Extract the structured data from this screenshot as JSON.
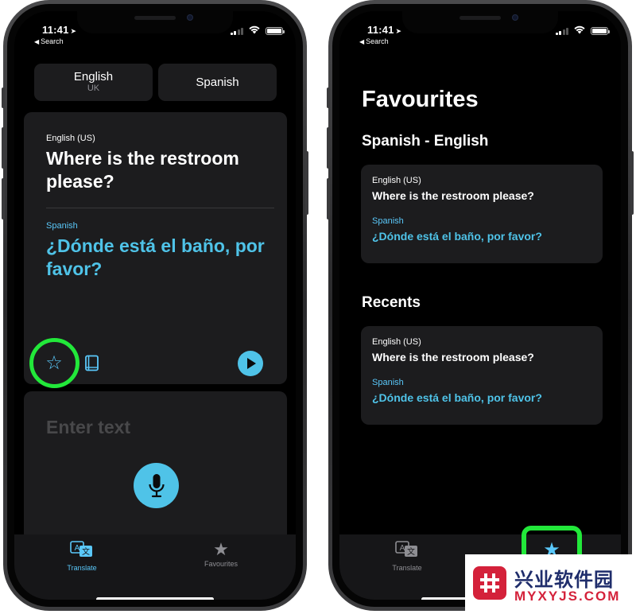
{
  "status_bar": {
    "time": "11:41",
    "back_label": "Search"
  },
  "translate_screen": {
    "source_language": {
      "name": "English",
      "region": "UK"
    },
    "target_language": {
      "name": "Spanish"
    },
    "translation": {
      "source_language_label": "English (US)",
      "source_text": "Where is the restroom please?",
      "target_language_label": "Spanish",
      "target_text": "¿Dónde está el baño, por favor?"
    },
    "input": {
      "placeholder": "Enter text"
    }
  },
  "favourites_screen": {
    "title": "Favourites",
    "favourites_section": {
      "heading": "Spanish - English",
      "items": [
        {
          "source_language": "English (US)",
          "source_text": "Where is the restroom please?",
          "target_language": "Spanish",
          "target_text": "¿Dónde está el baño, por favor?"
        }
      ]
    },
    "recents_section": {
      "heading": "Recents",
      "items": [
        {
          "source_language": "English (US)",
          "source_text": "Where is the restroom please?",
          "target_language": "Spanish",
          "target_text": "¿Dónde está el baño, por favor?"
        }
      ]
    }
  },
  "tab_bar": {
    "tabs": [
      {
        "label": "Translate",
        "icon": "translate-icon"
      },
      {
        "label": "Favourites",
        "icon": "star-icon"
      }
    ]
  },
  "watermark": {
    "chinese_text": "兴业软件园",
    "latin_text": "MYXYJS.COM"
  },
  "colors": {
    "accent": "#4fc3e8",
    "highlight": "#22e83a",
    "card": "#1c1c1e",
    "watermark_red": "#d4213a",
    "watermark_navy": "#1f2d6b"
  }
}
